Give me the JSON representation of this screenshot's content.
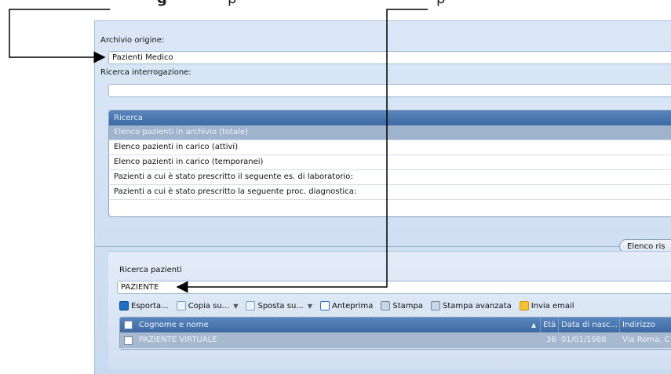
{
  "top_fragments": {
    "a": "g",
    "b": "p",
    "c": "p"
  },
  "archive": {
    "label": "Archivio origine:",
    "value": "Pazienti Medico"
  },
  "query": {
    "label": "Ricerca interrogazione:",
    "value": ""
  },
  "search_list": {
    "header": "Ricerca",
    "items": [
      "Elenco pazienti in archivio (totale)",
      "Elenco pazienti in carico (attivi)",
      "Elenco pazienti in carico (temporanei)",
      "Pazienti a cui è stato prescritto il seguente es. di laboratorio:",
      "Pazienti a cui è stato prescritto la seguente proc. diagnostica:"
    ]
  },
  "results_tab": "Elenco ris",
  "patients_panel": {
    "label": "Ricerca pazienti",
    "search_value": "PAZIENTE"
  },
  "toolbar": {
    "export": "Esporta...",
    "copy": "Copia su...",
    "move": "Sposta su...",
    "preview": "Anteprima",
    "print": "Stampa",
    "print_adv": "Stampa avanzata",
    "email": "Invia email"
  },
  "grid": {
    "columns": [
      "Cognome e nome",
      "Età",
      "Data di nasc...",
      "Indirizzo"
    ],
    "sort_indicator": "▲",
    "rows": [
      [
        "PAZIENTE VIRTUALE",
        "36",
        "01/01/1988",
        "Via Roma, C"
      ]
    ]
  },
  "colors": {
    "header_blue": "#3e6aa3",
    "selected_row": "#9fb3cd",
    "window_bg": "#d3e0f1"
  }
}
